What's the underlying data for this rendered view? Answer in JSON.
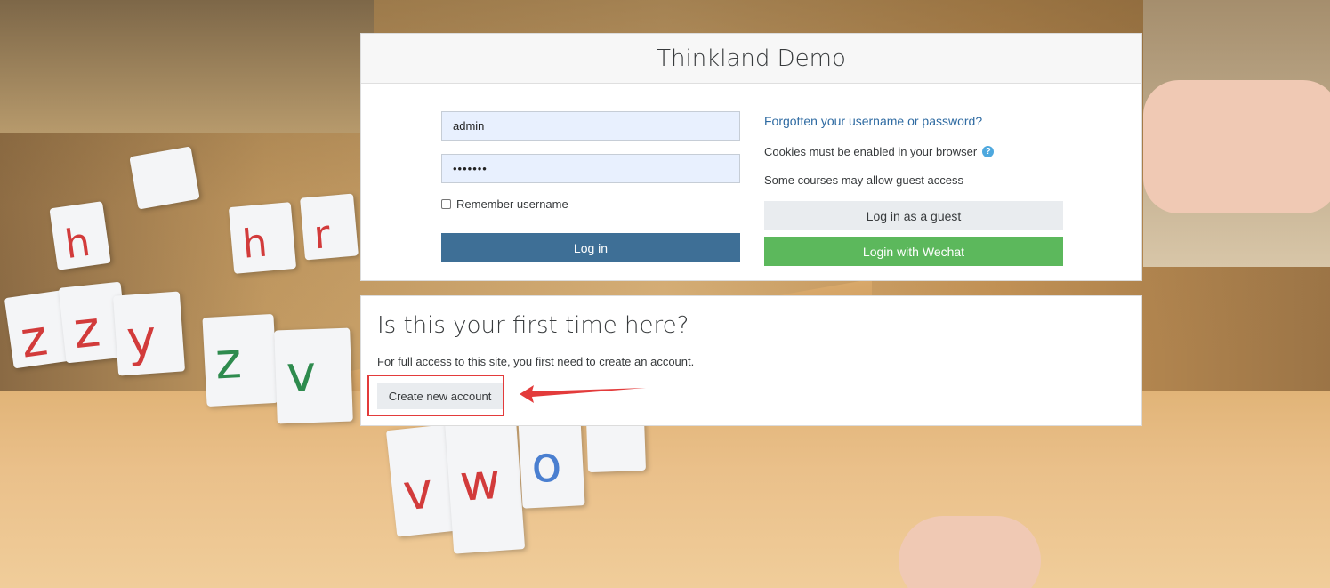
{
  "login": {
    "site_title": "Thinkland Demo",
    "username_value": "admin",
    "password_value": "•••••••",
    "remember_label": "Remember username",
    "login_button": "Log in",
    "forgot_link": "Forgotten your username or password?",
    "cookies_note": "Cookies must be enabled in your browser",
    "help_icon": "question-circle-icon",
    "guest_note": "Some courses may allow guest access",
    "guest_button": "Log in as a guest",
    "wechat_button": "Login with Wechat"
  },
  "signup": {
    "title": "Is this your first time here?",
    "description": "For full access to this site, you first need to create an account.",
    "create_button": "Create new account"
  },
  "annotation": {
    "highlight_color": "#e33b3b"
  },
  "colors": {
    "login_button": "#3e6f96",
    "wechat_button": "#5cb85c",
    "link": "#2f6ba2"
  }
}
